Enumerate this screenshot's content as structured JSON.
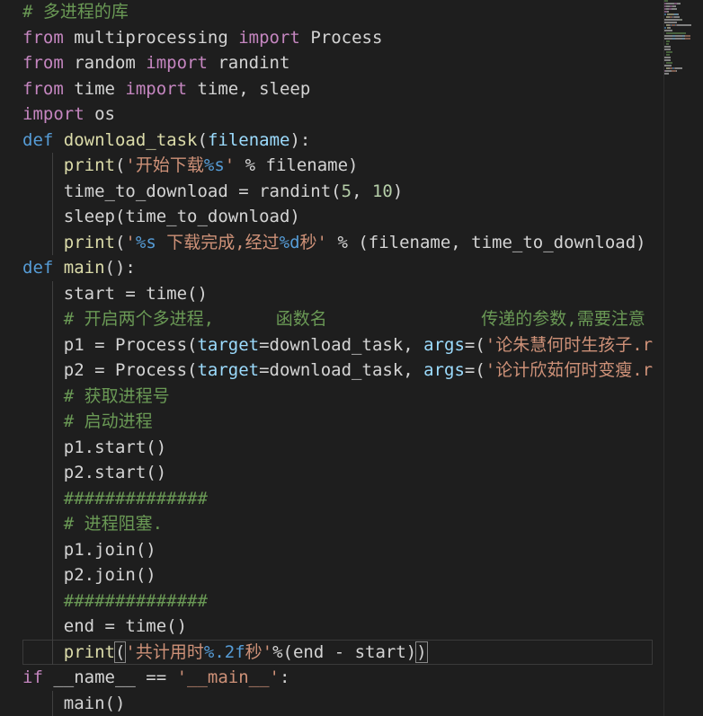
{
  "colors": {
    "background": "#1e1e1e",
    "keyword_purple": "#c586c0",
    "keyword_blue": "#569cd6",
    "function": "#dcdcaa",
    "parameter": "#9cdcfe",
    "class": "#4ec9b0",
    "string": "#ce9178",
    "number": "#b5cea8",
    "comment": "#6a9955",
    "text": "#d4d4d4"
  },
  "code": {
    "lines": [
      [
        {
          "t": "# 多进程的库",
          "c": "com"
        }
      ],
      [
        {
          "t": "from",
          "c": "kw-purple"
        },
        {
          "t": " multiprocessing ",
          "c": "plain"
        },
        {
          "t": "import",
          "c": "kw-purple"
        },
        {
          "t": " Process",
          "c": "plain"
        }
      ],
      [
        {
          "t": "from",
          "c": "kw-purple"
        },
        {
          "t": " random ",
          "c": "plain"
        },
        {
          "t": "import",
          "c": "kw-purple"
        },
        {
          "t": " randint",
          "c": "plain"
        }
      ],
      [
        {
          "t": "from",
          "c": "kw-purple"
        },
        {
          "t": " time ",
          "c": "plain"
        },
        {
          "t": "import",
          "c": "kw-purple"
        },
        {
          "t": " time, sleep",
          "c": "plain"
        }
      ],
      [
        {
          "t": "import",
          "c": "kw-purple"
        },
        {
          "t": " os",
          "c": "plain"
        }
      ],
      [
        {
          "t": "def",
          "c": "kw-blue"
        },
        {
          "t": " ",
          "c": "plain"
        },
        {
          "t": "download_task",
          "c": "fn"
        },
        {
          "t": "(",
          "c": "plain"
        },
        {
          "t": "filename",
          "c": "param"
        },
        {
          "t": "):",
          "c": "plain"
        }
      ],
      [
        {
          "t": "    ",
          "c": "plain"
        },
        {
          "t": "print",
          "c": "fn"
        },
        {
          "t": "(",
          "c": "plain"
        },
        {
          "t": "'开始下载",
          "c": "str"
        },
        {
          "t": "%s",
          "c": "kw-blue"
        },
        {
          "t": "'",
          "c": "str"
        },
        {
          "t": " % filename)",
          "c": "plain"
        }
      ],
      [
        {
          "t": "    time_to_download = randint(",
          "c": "plain"
        },
        {
          "t": "5",
          "c": "num"
        },
        {
          "t": ", ",
          "c": "plain"
        },
        {
          "t": "10",
          "c": "num"
        },
        {
          "t": ")",
          "c": "plain"
        }
      ],
      [
        {
          "t": "    sleep(time_to_download)",
          "c": "plain"
        }
      ],
      [
        {
          "t": "    ",
          "c": "plain"
        },
        {
          "t": "print",
          "c": "fn"
        },
        {
          "t": "(",
          "c": "plain"
        },
        {
          "t": "'",
          "c": "str"
        },
        {
          "t": "%s",
          "c": "kw-blue"
        },
        {
          "t": " 下载完成,经过",
          "c": "str"
        },
        {
          "t": "%d",
          "c": "kw-blue"
        },
        {
          "t": "秒'",
          "c": "str"
        },
        {
          "t": " % (filename, time_to_download)",
          "c": "plain"
        }
      ],
      [
        {
          "t": "def",
          "c": "kw-blue"
        },
        {
          "t": " ",
          "c": "plain"
        },
        {
          "t": "main",
          "c": "fn"
        },
        {
          "t": "():",
          "c": "plain"
        }
      ],
      [
        {
          "t": "    start = time()",
          "c": "plain"
        }
      ],
      [
        {
          "t": "    ",
          "c": "plain"
        },
        {
          "t": "# 开启两个多进程,      函数名               传递的参数,需要注意",
          "c": "com"
        }
      ],
      [
        {
          "t": "    p1 = Process(",
          "c": "plain"
        },
        {
          "t": "target",
          "c": "param"
        },
        {
          "t": "=download_task, ",
          "c": "plain"
        },
        {
          "t": "args",
          "c": "param"
        },
        {
          "t": "=(",
          "c": "plain"
        },
        {
          "t": "'论朱慧何时生孩子.r",
          "c": "str"
        }
      ],
      [
        {
          "t": "    p2 = Process(",
          "c": "plain"
        },
        {
          "t": "target",
          "c": "param"
        },
        {
          "t": "=download_task, ",
          "c": "plain"
        },
        {
          "t": "args",
          "c": "param"
        },
        {
          "t": "=(",
          "c": "plain"
        },
        {
          "t": "'论计欣茹何时变瘦.r",
          "c": "str"
        }
      ],
      [
        {
          "t": "    ",
          "c": "plain"
        },
        {
          "t": "# 获取进程号",
          "c": "com"
        }
      ],
      [
        {
          "t": "    ",
          "c": "plain"
        },
        {
          "t": "# 启动进程",
          "c": "com"
        }
      ],
      [
        {
          "t": "    p1.start()",
          "c": "plain"
        }
      ],
      [
        {
          "t": "    p2.start()",
          "c": "plain"
        }
      ],
      [
        {
          "t": "    ",
          "c": "plain"
        },
        {
          "t": "##############",
          "c": "com"
        }
      ],
      [
        {
          "t": "    ",
          "c": "plain"
        },
        {
          "t": "# 进程阻塞.",
          "c": "com"
        }
      ],
      [
        {
          "t": "    p1.join()",
          "c": "plain"
        }
      ],
      [
        {
          "t": "    p2.join()",
          "c": "plain"
        }
      ],
      [
        {
          "t": "    ",
          "c": "plain"
        },
        {
          "t": "##############",
          "c": "com"
        }
      ],
      [
        {
          "t": "    end = time()",
          "c": "plain"
        }
      ],
      [
        {
          "t": "    ",
          "c": "plain"
        },
        {
          "t": "print",
          "c": "fn"
        },
        {
          "t": "(",
          "c": "plain",
          "m": true
        },
        {
          "t": "'共计用时",
          "c": "str"
        },
        {
          "t": "%.2f",
          "c": "kw-blue"
        },
        {
          "t": "秒'",
          "c": "str"
        },
        {
          "t": "%(end - start)",
          "c": "plain"
        },
        {
          "t": ")",
          "c": "plain",
          "m": true
        }
      ],
      [
        {
          "t": "if",
          "c": "kw-purple"
        },
        {
          "t": " __name__ == ",
          "c": "plain"
        },
        {
          "t": "'__main__'",
          "c": "str"
        },
        {
          "t": ":",
          "c": "plain"
        }
      ],
      [
        {
          "t": "    main()",
          "c": "plain"
        }
      ]
    ],
    "active_line": 25
  }
}
